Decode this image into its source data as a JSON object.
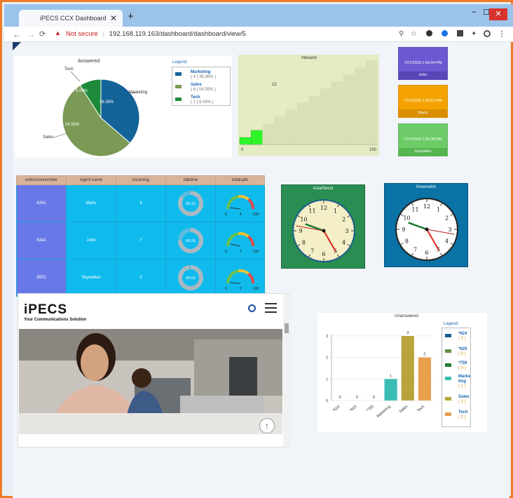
{
  "browser": {
    "tab_title": "iPECS CCX Dashboard",
    "new_tab": "+",
    "not_secure": "Not secure",
    "separator": "|",
    "url": "192.168.119.163/dashboard/dashboard/view/5",
    "minimize": "–",
    "maximize": "☐",
    "close": "✕"
  },
  "answered": {
    "title": "Answered",
    "legend_title": "Legend:",
    "slices": [
      {
        "name": "Marketing",
        "count": 4,
        "pct": "36.36%",
        "color": "#136398",
        "legend_sub": "( 4 [ 36.36% ) "
      },
      {
        "name": "Sales",
        "count": 6,
        "pct": "54.55%",
        "color": "#7a9a55",
        "legend_sub": "( 6 [ 54.55% )"
      },
      {
        "name": "Tech",
        "count": 1,
        "pct": "9.09%",
        "color": "#1d8a3a",
        "legend_sub": "( 1 [ 9.09% )"
      }
    ],
    "label_marketing_pct": "36.36%",
    "label_sales_pct": "54.55%",
    "label_tech_pct": "9.09%"
  },
  "inbound": {
    "title": "Inbound",
    "value_label": "12",
    "axis_min": "0",
    "axis_max": "100"
  },
  "agents": [
    {
      "time": "7/27/2020 1:56:44 PM",
      "name": "John",
      "color": "#6a59d1",
      "bar": "#5846b8"
    },
    {
      "time": "7/27/2020 1:56:53 PM",
      "name": "Mario",
      "color": "#f3a200",
      "bar": "#d98d00"
    },
    {
      "time": "7/27/2020 1:55:38 PM",
      "name": "Skywalker",
      "color": "#6dcb68",
      "bar": "#55b54f"
    }
  ],
  "table": {
    "headers": [
      "extensionnumber",
      "Agent name",
      "incoming",
      "talktime",
      "totalcalls"
    ],
    "rows": [
      {
        "ext": "6341",
        "agent": "Mario",
        "incoming": "4",
        "talktime": "00:15",
        "calls": "4",
        "gmin": "0",
        "gmax": "100",
        "talk_fraction": 0.85
      },
      {
        "ext": "6342",
        "agent": "John",
        "incoming": "7",
        "talktime": "00:25",
        "calls": "7",
        "gmin": "0",
        "gmax": "100",
        "talk_fraction": 0.75
      },
      {
        "ext": "6501",
        "agent": "Skywalker",
        "incoming": "2",
        "talktime": "00:02",
        "calls": "2",
        "gmin": "0",
        "gmax": "100",
        "talk_fraction": 0.98
      }
    ]
  },
  "clocks": [
    {
      "title": "Asia/Seoul",
      "bg": "#2a8d52"
    },
    {
      "title": "Greenwich",
      "bg": "#0b72a6"
    }
  ],
  "clock_numbers": [
    "12",
    "1",
    "2",
    "3",
    "4",
    "5",
    "6",
    "7",
    "8",
    "9",
    "10",
    "11"
  ],
  "website": {
    "logo": "iPECS",
    "tagline": "Your Communications Solution",
    "search_icon": "search-icon",
    "menu_icon": "hamburger-icon"
  },
  "chart_data": {
    "type": "bar",
    "title": "Unanswered",
    "categories": [
      "*624",
      "*625",
      "*759",
      "Marketing",
      "Sales",
      "Tech"
    ],
    "values": [
      0,
      0,
      0,
      1,
      3,
      2
    ],
    "colors": [
      "#13608f",
      "#6c8a4a",
      "#1d7c36",
      "#3bbdb3",
      "#b9a33c",
      "#e99f4c"
    ],
    "ylim": [
      0,
      3
    ],
    "yticks": [
      "0",
      "1",
      "2",
      "3"
    ],
    "legend_title": "Legend:",
    "legend": [
      {
        "name": "*624",
        "sub": "( 0 )"
      },
      {
        "name": "*625",
        "sub": "( 0 )"
      },
      {
        "name": "*759",
        "sub": "( 0 )"
      },
      {
        "name": "Marke\nting",
        "sub": "( 1 )"
      },
      {
        "name": "Sales",
        "sub": "( 3 )"
      },
      {
        "name": "Tech",
        "sub": "( 2 )"
      }
    ]
  }
}
